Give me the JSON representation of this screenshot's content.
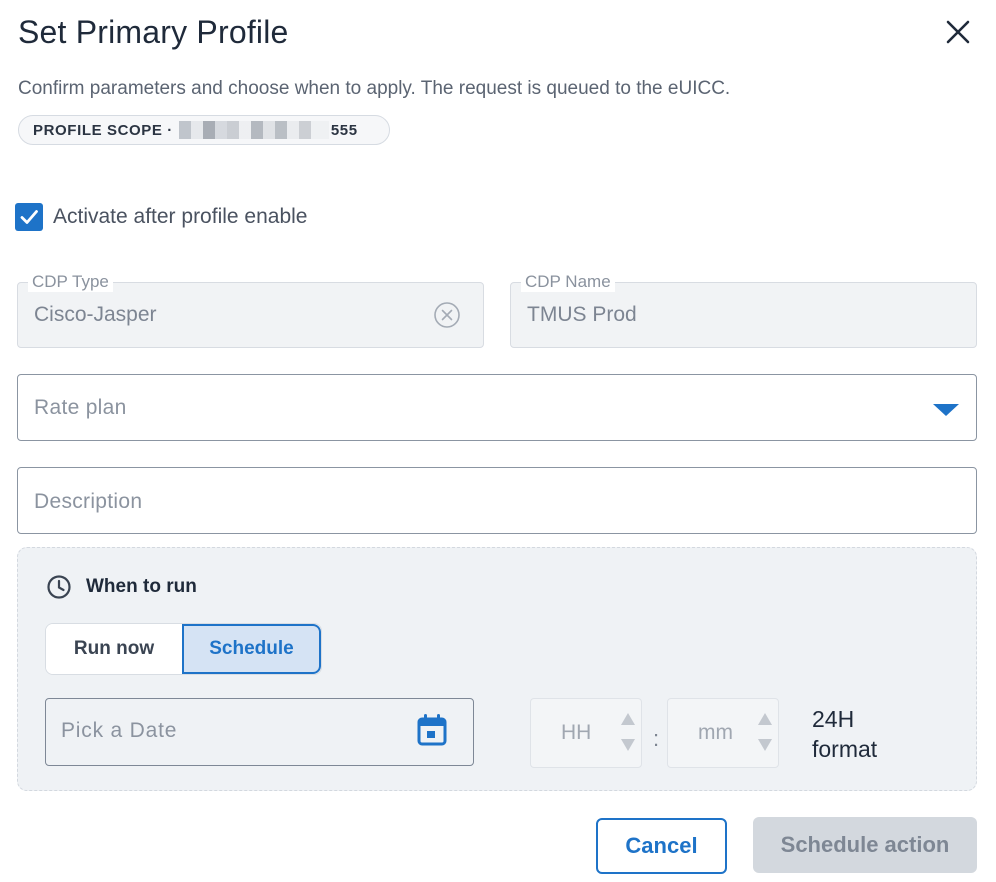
{
  "dialog": {
    "title": "Set Primary Profile",
    "subtitle": "Confirm parameters and choose when to apply. The request is queued to the eUICC.",
    "scope_prefix": "PROFILE SCOPE ·",
    "scope_suffix": "555"
  },
  "activate": {
    "label": "Activate after profile enable",
    "checked": true
  },
  "cdp_type": {
    "label": "CDP Type",
    "value": "Cisco-Jasper"
  },
  "cdp_name": {
    "label": "CDP Name",
    "value": "TMUS Prod"
  },
  "rate_plan": {
    "placeholder": "Rate plan"
  },
  "description": {
    "placeholder": "Description"
  },
  "when_to_run": {
    "label": "When to run",
    "options": [
      "Run now",
      "Schedule"
    ],
    "selected": "Schedule"
  },
  "date": {
    "placeholder": "Pick a Date"
  },
  "time": {
    "hour_placeholder": "HH",
    "minute_placeholder": "mm",
    "separator": ":",
    "format_line1": "24H",
    "format_line2": "format"
  },
  "actions": {
    "cancel_label": "Cancel",
    "submit_label": "Schedule action"
  },
  "colors": {
    "accent": "#1e73c8",
    "disabled_button": "#d3d8de",
    "panel_bg": "#eff2f5"
  },
  "icons": {
    "close": "close-icon",
    "checkbox": "check-icon",
    "clear": "clear-circle-icon",
    "dropdown": "caret-down-icon",
    "clock": "clock-icon",
    "calendar": "calendar-icon"
  }
}
